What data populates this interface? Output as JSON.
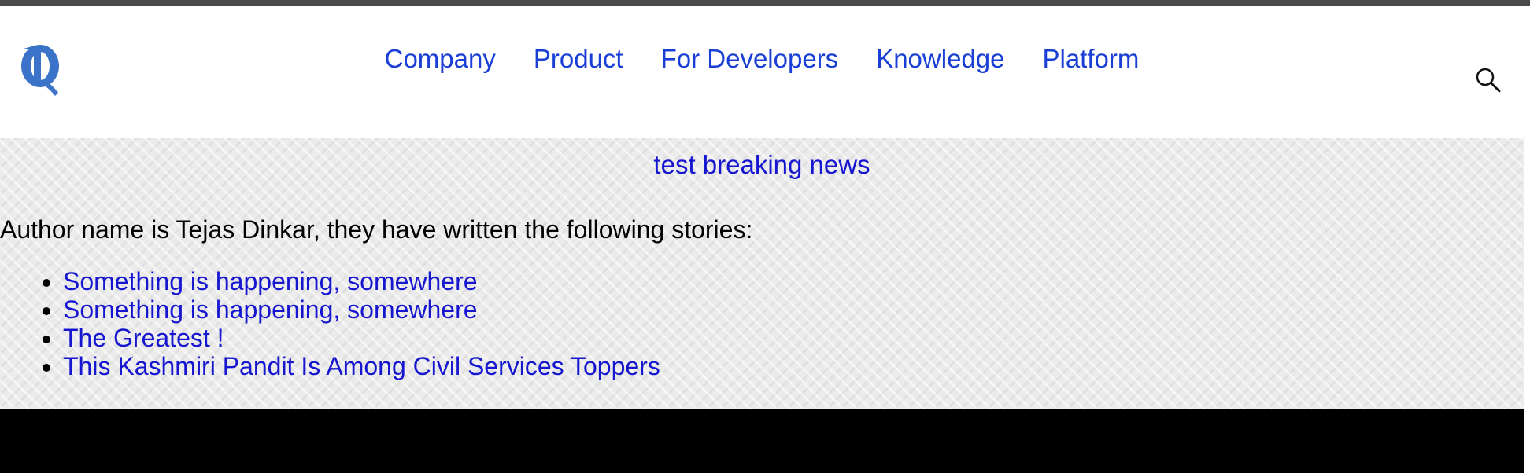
{
  "header": {
    "logo": {
      "icon": "q-logo-icon",
      "color": "#3b73c9"
    },
    "nav": [
      {
        "label": "Company"
      },
      {
        "label": "Product"
      },
      {
        "label": "For Developers"
      },
      {
        "label": "Knowledge"
      },
      {
        "label": "Platform"
      }
    ],
    "search": {
      "icon": "search-icon"
    }
  },
  "main": {
    "breaking_news": "test breaking news",
    "author_intro": "Author name is Tejas Dinkar, they have written the following stories:",
    "stories": [
      {
        "title": "Something is happening, somewhere"
      },
      {
        "title": "Something is happening, somewhere"
      },
      {
        "title": "The Greatest !"
      },
      {
        "title": "This Kashmiri Pandit Is Among Civil Services Toppers"
      }
    ]
  },
  "colors": {
    "link": "#1616d0",
    "nav_link": "#1a3fd6",
    "footer": "#000000",
    "background_pattern": "#ebebeb"
  }
}
